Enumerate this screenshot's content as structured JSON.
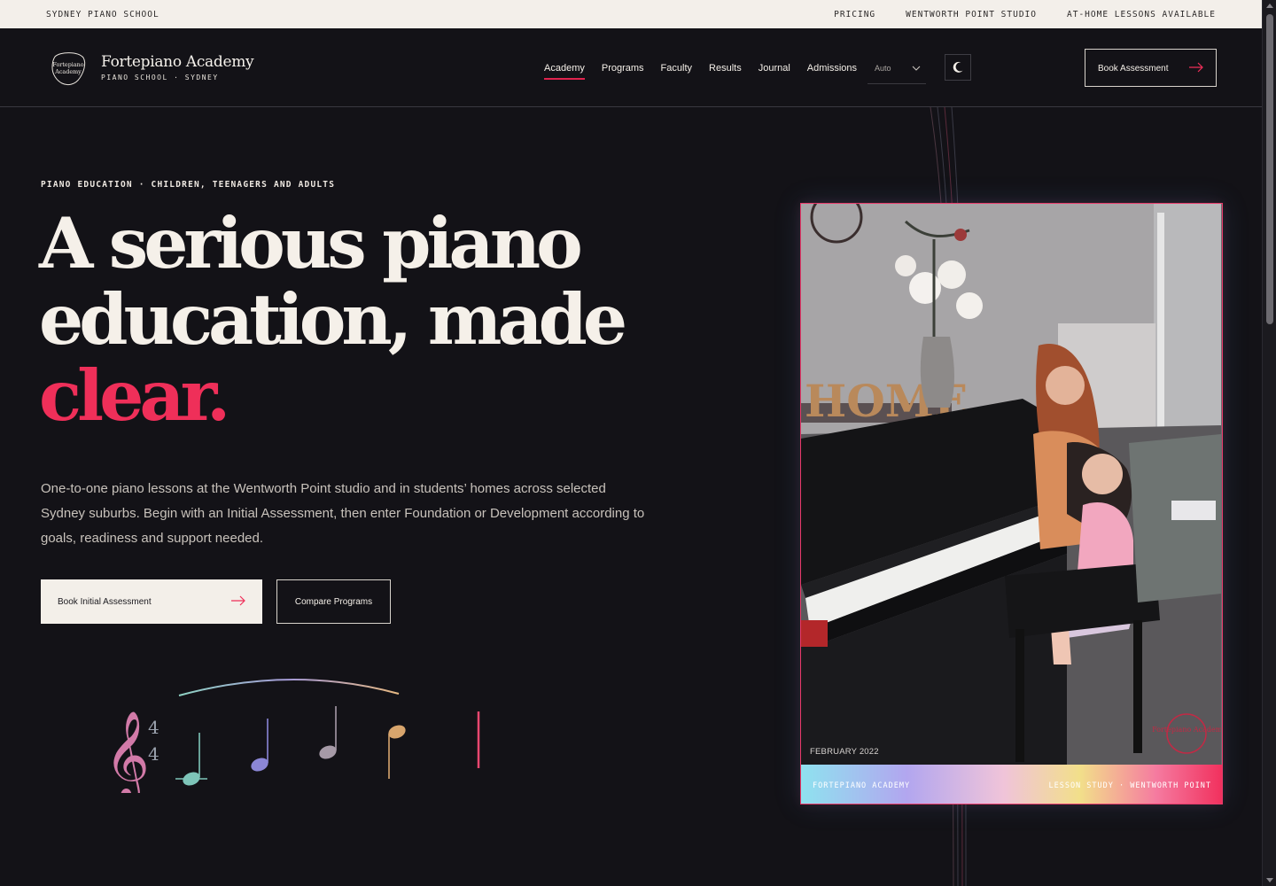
{
  "topbar": {
    "brand": "SYDNEY PIANO SCHOOL",
    "links": [
      "PRICING",
      "WENTWORTH POINT STUDIO",
      "AT-HOME LESSONS AVAILABLE"
    ]
  },
  "nav": {
    "logo_mark_text": "Fortepiano Academy",
    "logo_name": "Fortepiano Academy",
    "logo_sub": "PIANO SCHOOL · SYDNEY",
    "menu": [
      "Academy",
      "Programs",
      "Faculty",
      "Results",
      "Journal",
      "Admissions"
    ],
    "active_item": "Academy",
    "language_select": "Auto",
    "theme_toggle_icon": "moon-icon",
    "cta_label": "Book Assessment"
  },
  "hero": {
    "eyebrow": "PIANO EDUCATION · CHILDREN, TEENAGERS AND ADULTS",
    "title_line1": "A serious piano",
    "title_line2": "education, made",
    "title_accent": "clear.",
    "description": "One-to-one piano lessons at the Wentworth Point studio and in students’ homes across selected Sydney suburbs. Begin with an Initial Assessment, then enter Foundation or Development according to goals, readiness and support needed.",
    "primary_button": "Book Initial Assessment",
    "secondary_button": "Compare Programs",
    "time_signature_top": "4",
    "time_signature_bottom": "4"
  },
  "photo_card": {
    "image_caption_date": "FEBRUARY 2022",
    "footer_left": "FORTEPIANO ACADEMY",
    "footer_right": "LESSON STUDY · WENTWORTH POINT",
    "wall_sign": "HOME",
    "watermark": "Fortepiano Academy"
  },
  "colors": {
    "background": "#131217",
    "accent": "#ef2f59",
    "topbar_bg": "#f3efea",
    "text_light": "#f4efe8"
  }
}
